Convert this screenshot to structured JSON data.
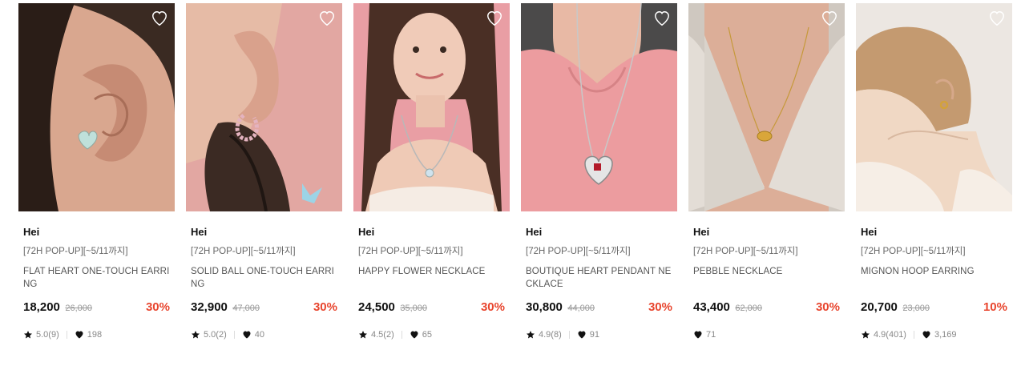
{
  "products": [
    {
      "brand": "Hei",
      "promo": "[72H POP-UP][~5/11까지]",
      "name": "FLAT HEART ONE-TOUCH EARRING",
      "price": "18,200",
      "original_price": "26,000",
      "discount": "30%",
      "rating": "5.0(9)",
      "likes": "198",
      "image_subject": "ear-with-heart-earring"
    },
    {
      "brand": "Hei",
      "promo": "[72H POP-UP][~5/11까지]",
      "name": "SOLID BALL ONE-TOUCH EARRING",
      "price": "32,900",
      "original_price": "47,000",
      "discount": "30%",
      "rating": "5.0(2)",
      "likes": "40",
      "image_subject": "ear-with-ball-hoop-earring"
    },
    {
      "brand": "Hei",
      "promo": "[72H POP-UP][~5/11까지]",
      "name": "HAPPY FLOWER NECKLACE",
      "price": "24,500",
      "original_price": "35,000",
      "discount": "30%",
      "rating": "4.5(2)",
      "likes": "65",
      "image_subject": "model-with-flower-necklace"
    },
    {
      "brand": "Hei",
      "promo": "[72H POP-UP][~5/11까지]",
      "name": "BOUTIQUE HEART PENDANT NECKLACE",
      "price": "30,800",
      "original_price": "44,000",
      "discount": "30%",
      "rating": "4.9(8)",
      "likes": "91",
      "image_subject": "neck-with-heart-pendant"
    },
    {
      "brand": "Hei",
      "promo": "[72H POP-UP][~5/11까지]",
      "name": "PEBBLE NECKLACE",
      "price": "43,400",
      "original_price": "62,000",
      "discount": "30%",
      "rating": "",
      "likes": "71",
      "image_subject": "neck-with-gold-pebble-necklace"
    },
    {
      "brand": "Hei",
      "promo": "[72H POP-UP][~5/11까지]",
      "name": "MIGNON HOOP EARRING",
      "price": "20,700",
      "original_price": "23,000",
      "discount": "10%",
      "rating": "4.9(401)",
      "likes": "3,169",
      "image_subject": "model-with-gold-hoop-earring"
    }
  ],
  "icons": {
    "wishlist": "heart-outline-icon",
    "rating": "star-icon",
    "likes": "heart-filled-icon"
  },
  "colors": {
    "discount": "#e8452e",
    "price": "#111111",
    "original_price": "#999999"
  }
}
